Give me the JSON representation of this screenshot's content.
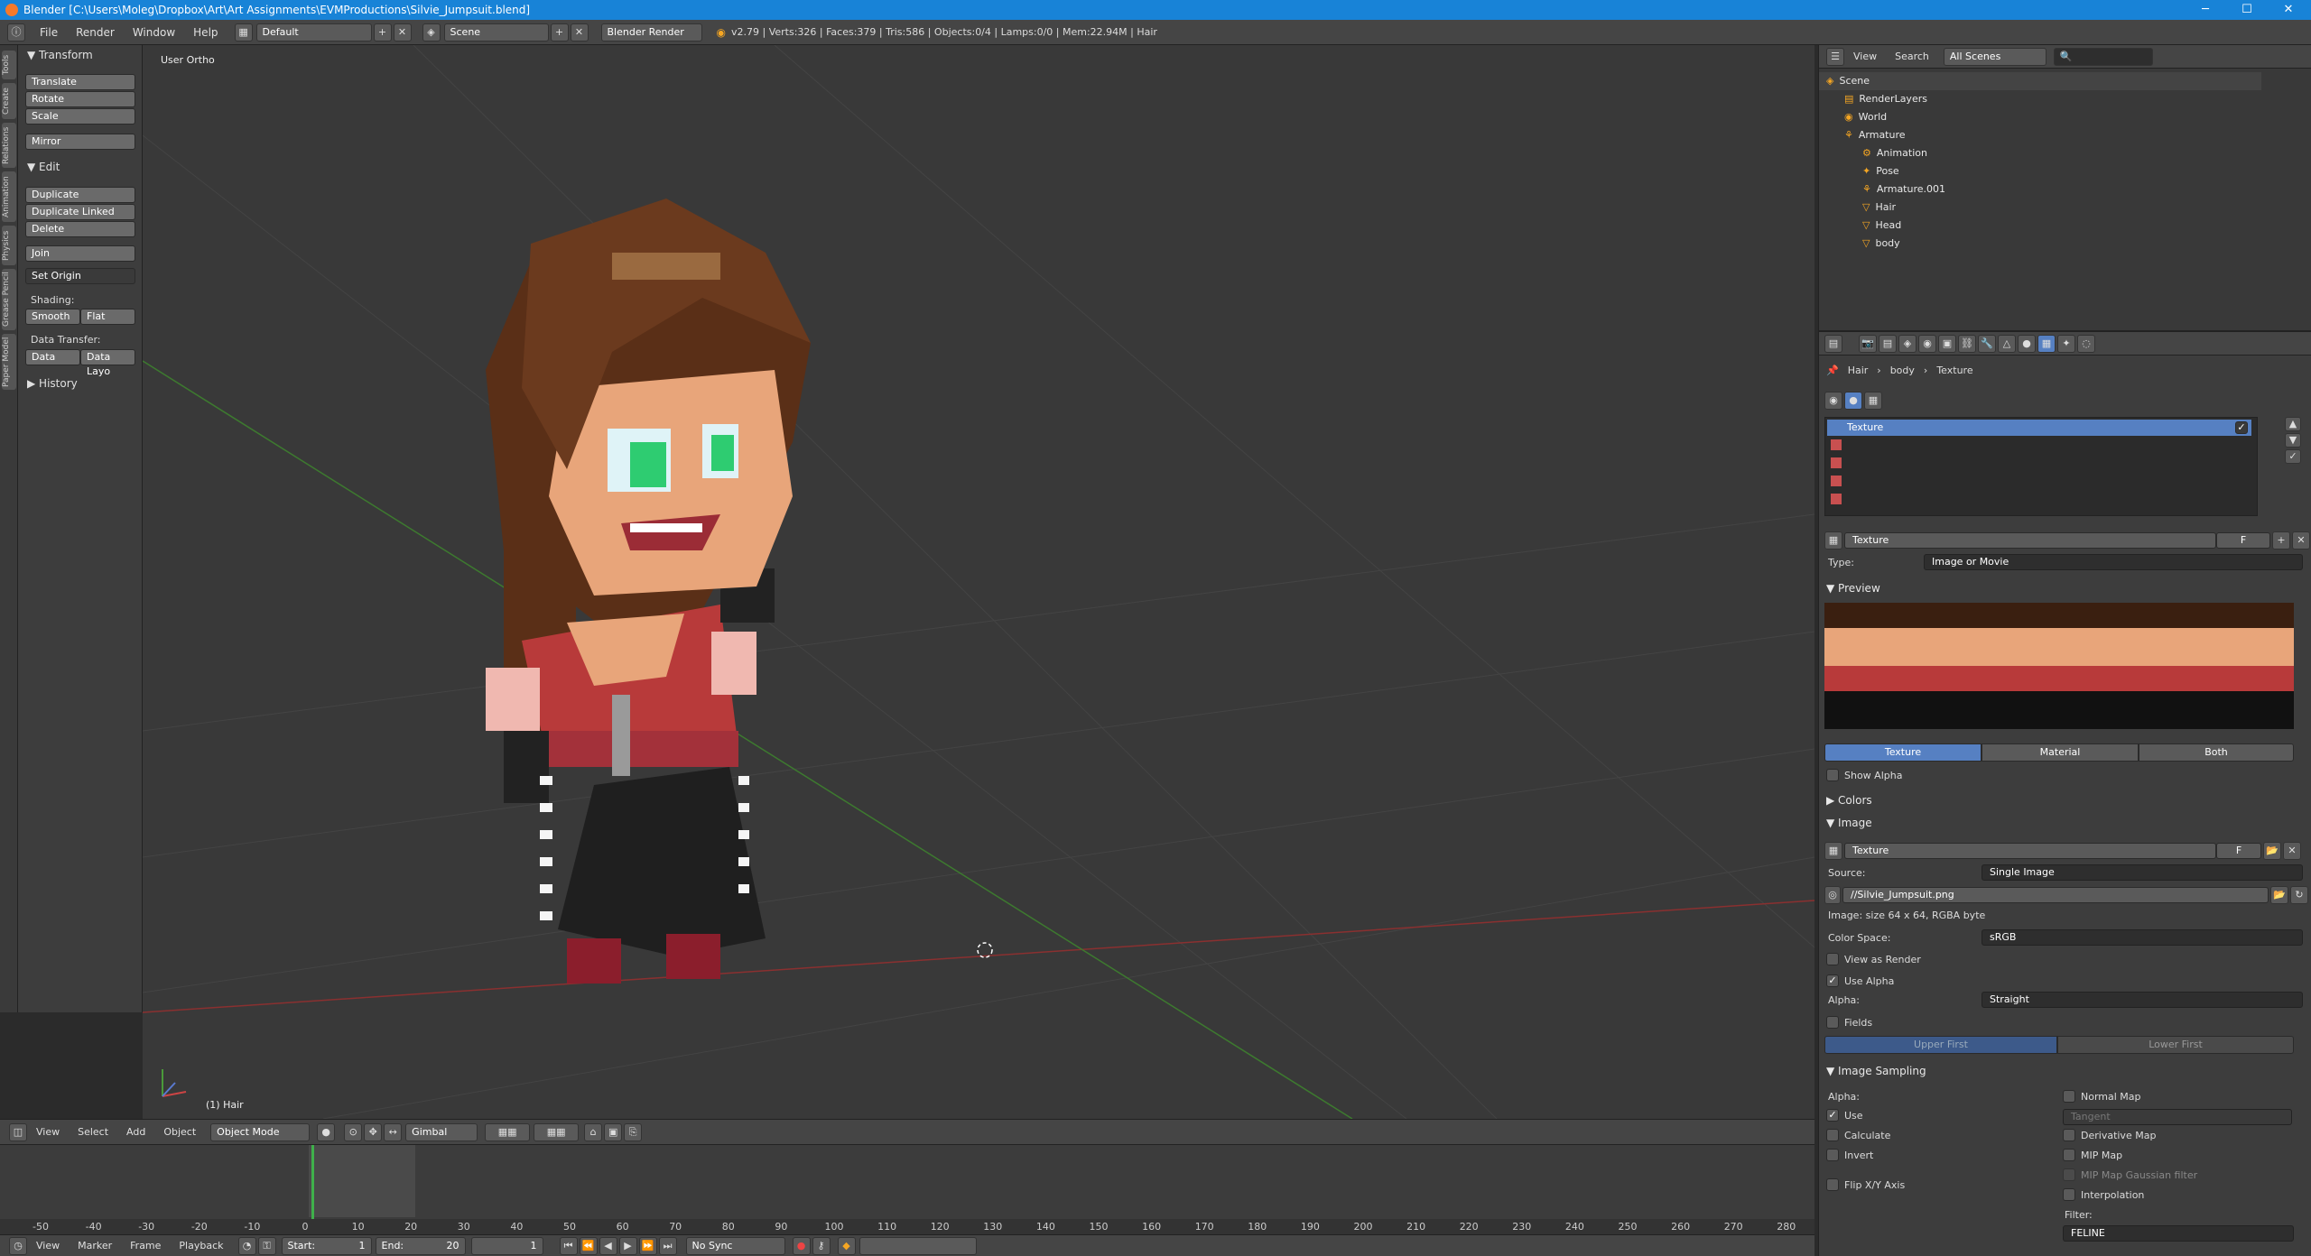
{
  "window": {
    "title": "Blender [C:\\Users\\Moleg\\Dropbox\\Art\\Art Assignments\\EVMProductions\\Silvie_Jumpsuit.blend]",
    "controls": [
      "─",
      "☐",
      "✕"
    ]
  },
  "info_header": {
    "menus": [
      "File",
      "Render",
      "Window",
      "Help"
    ],
    "layout": "Default",
    "scene": "Scene",
    "engine": "Blender Render",
    "stats": "v2.79 | Verts:326 | Faces:379 | Tris:586 | Objects:0/4 | Lamps:0/0 | Mem:22.94M | Hair"
  },
  "tool_tabs": [
    "Tools",
    "Create",
    "Relations",
    "Animation",
    "Physics",
    "Grease Pencil",
    "Paper Model"
  ],
  "toolshelf": {
    "transform_header": "Transform",
    "transform_buttons": [
      "Translate",
      "Rotate",
      "Scale"
    ],
    "mirror": "Mirror",
    "edit_header": "Edit",
    "edit_buttons": [
      "Duplicate",
      "Duplicate Linked",
      "Delete"
    ],
    "join": "Join",
    "set_origin": "Set Origin",
    "shading_label": "Shading:",
    "shading_buttons": [
      "Smooth",
      "Flat"
    ],
    "data_transfer_label": "Data Transfer:",
    "data_transfer_buttons": [
      "Data",
      "Data Layo"
    ],
    "history_header": "History"
  },
  "viewport": {
    "view_label": "User Ortho",
    "object_label": "(1) Hair"
  },
  "view_header": {
    "menus": [
      "View",
      "Select",
      "Add",
      "Object"
    ],
    "mode": "Object Mode",
    "orientation": "Gimbal"
  },
  "timeline": {
    "ticks": [
      "-50",
      "-40",
      "-30",
      "-20",
      "-10",
      "0",
      "10",
      "20",
      "30",
      "40",
      "50",
      "60",
      "70",
      "80",
      "90",
      "100",
      "110",
      "120",
      "130",
      "140",
      "150",
      "160",
      "170",
      "180",
      "190",
      "200",
      "210",
      "220",
      "230",
      "240",
      "250",
      "260",
      "270",
      "280"
    ],
    "current_frame": 0
  },
  "timeline_header": {
    "menus": [
      "View",
      "Marker",
      "Frame",
      "Playback"
    ],
    "start": "Start:",
    "start_value": "1",
    "end": "End:",
    "end_value": "20",
    "frame_value": "1",
    "sync": "No Sync"
  },
  "outliner": {
    "menus": [
      "View",
      "Search"
    ],
    "scenes_dropdown": "All Scenes",
    "rows": [
      {
        "label": "Scene",
        "indent": 0
      },
      {
        "label": "RenderLayers",
        "indent": 1
      },
      {
        "label": "World",
        "indent": 1
      },
      {
        "label": "Armature",
        "indent": 1
      },
      {
        "label": "Animation",
        "indent": 2
      },
      {
        "label": "Pose",
        "indent": 2
      },
      {
        "label": "Armature.001",
        "indent": 2
      },
      {
        "label": "Hair",
        "indent": 2
      },
      {
        "label": "Head",
        "indent": 2
      },
      {
        "label": "body",
        "indent": 2
      }
    ]
  },
  "properties": {
    "breadcrumb": [
      "Hair",
      "body",
      "Texture"
    ],
    "texture_slot": "Texture",
    "texture_name": "Texture",
    "fake_user": "F",
    "type_label": "Type:",
    "type_value": "Image or Movie",
    "preview_header": "Preview",
    "preview_tabs": [
      "Texture",
      "Material",
      "Both"
    ],
    "show_alpha": "Show Alpha",
    "colors_header": "Colors",
    "image_header": "Image",
    "image_name": "Texture",
    "source_label": "Source:",
    "source_value": "Single Image",
    "filepath": "//Silvie_Jumpsuit.png",
    "image_size": "Image: size 64 x 64, RGBA byte",
    "color_space_label": "Color Space:",
    "color_space_value": "sRGB",
    "view_as_render": "View as Render",
    "use_alpha": "Use Alpha",
    "alpha_label": "Alpha:",
    "alpha_value": "Straight",
    "fields": "Fields",
    "field_order": [
      "Upper First",
      "Lower First"
    ],
    "sampling_header": "Image Sampling",
    "sampling_alpha_label": "Alpha:",
    "sampling_left": [
      "Use",
      "Calculate",
      "Invert"
    ],
    "flip_xy": "Flip X/Y Axis",
    "sampling_right": [
      "Normal Map",
      "Tangent",
      "Derivative Map",
      "MIP Map",
      "MIP Map Gaussian filter",
      "Interpolation"
    ],
    "filter_label": "Filter:",
    "filter_value": "FELINE"
  },
  "colors": {
    "accent": "#5680c2",
    "titlebar": "#1883d7",
    "character_hair": "#6b3a1e",
    "character_shirt": "#b83a3a",
    "character_skin": "#e8a57a"
  }
}
